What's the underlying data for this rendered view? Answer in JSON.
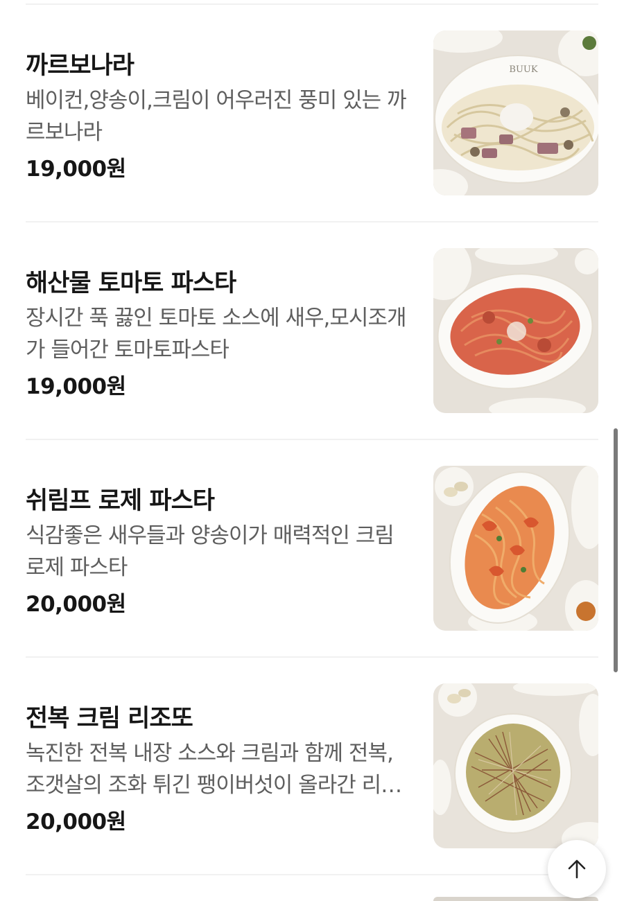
{
  "menu": {
    "items": [
      {
        "name": "까르보나라",
        "description": "베이컨,양송이,크림이 어우러진 풍미 있는 까르보나라",
        "price": "19,000원",
        "photo_icon": "carbonara-photo",
        "plate_logo": "BUUK",
        "sauce_color": "#efe6cf",
        "pasta_color": "#dccfa8"
      },
      {
        "name": "해산물 토마토 파스타",
        "description": "장시간 푹 끓인 토마토 소스에 새우,모시조개가 들어간 토마토파스타",
        "price": "19,000원",
        "photo_icon": "seafood-tomato-pasta-photo",
        "sauce_color": "#d9644a",
        "pasta_color": "#e0794e"
      },
      {
        "name": "쉬림프 로제 파스타",
        "description": "식감좋은 새우들과 양송이가 매력적인 크림 로제 파스타",
        "price": "20,000원",
        "photo_icon": "shrimp-rose-pasta-photo",
        "sauce_color": "#e98a4f",
        "pasta_color": "#e79a55"
      },
      {
        "name": "전복 크림 리조또",
        "description": "녹진한 전복 내장 소스와 크림과 함께 전복,조갯살의 조화 튀긴 팽이버섯이 올라간 리조또",
        "price": "20,000원",
        "photo_icon": "abalone-cream-risotto-photo",
        "sauce_color": "#b9ad6f",
        "pasta_color": "#c7a46a"
      }
    ]
  },
  "controls": {
    "scroll_top_icon": "arrow-up-icon"
  },
  "colors": {
    "divider": "#f1f1f1",
    "name_text": "#161616",
    "desc_text": "#5e5e5e",
    "plate": "#fbfaf7",
    "table": "#ece8e2"
  }
}
